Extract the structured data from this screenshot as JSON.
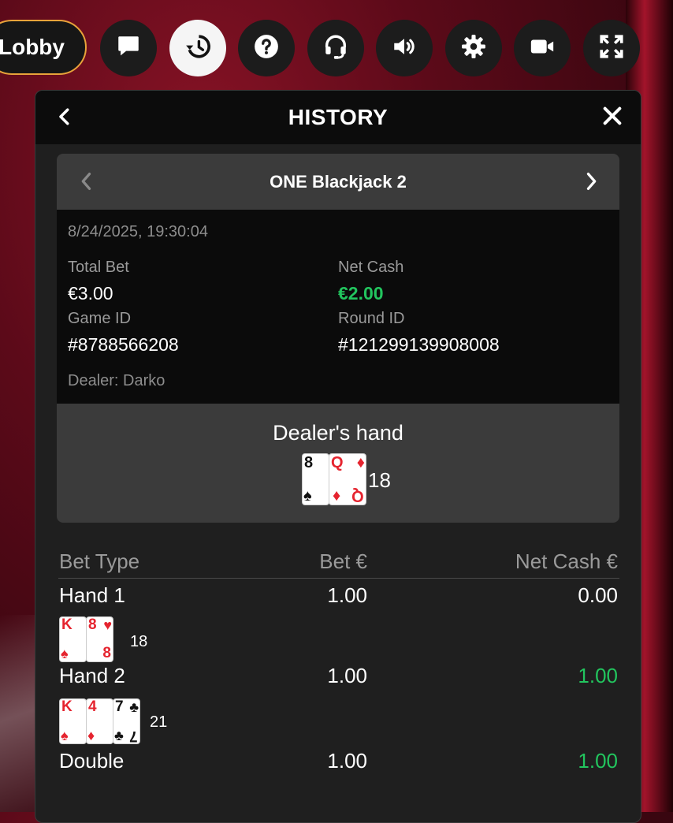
{
  "topbar": {
    "lobby_label": "Lobby",
    "icons": [
      "chat-icon",
      "history-icon",
      "help-icon",
      "support-icon",
      "sound-icon",
      "settings-icon",
      "video-icon",
      "fullscreen-icon"
    ],
    "active_icon": "history-icon",
    "accent": "#e8a33a"
  },
  "panel": {
    "title": "HISTORY"
  },
  "round": {
    "game_name": "ONE Blackjack 2",
    "timestamp": "8/24/2025, 19:30:04",
    "total_bet_label": "Total Bet",
    "total_bet": "€3.00",
    "net_cash_label": "Net Cash",
    "net_cash": "€2.00",
    "game_id_label": "Game ID",
    "game_id": "#8788566208",
    "round_id_label": "Round ID",
    "round_id": "#121299139908008",
    "dealer": "Dealer: Darko",
    "win_color": "#22c55e"
  },
  "dealer_hand": {
    "title": "Dealer's hand",
    "cards": [
      {
        "rank": "8",
        "suit": "♠",
        "color": "black"
      },
      {
        "rank": "Q",
        "suit": "♦",
        "color": "red"
      }
    ],
    "total": "18"
  },
  "table": {
    "headers": [
      "Bet Type",
      "Bet €",
      "Net Cash €"
    ],
    "rows": [
      {
        "type": "Hand 1",
        "bet": "1.00",
        "net": "0.00",
        "cards": [
          {
            "rank": "K",
            "suit": "♠",
            "color": "red"
          },
          {
            "rank": "8",
            "suit": "♥",
            "color": "red"
          }
        ],
        "total": "18"
      },
      {
        "type": "Hand 2",
        "bet": "1.00",
        "net": "1.00",
        "cards": [
          {
            "rank": "K",
            "suit": "♠",
            "color": "red"
          },
          {
            "rank": "4",
            "suit": "♦",
            "color": "red"
          },
          {
            "rank": "7",
            "suit": "♣",
            "color": "black"
          }
        ],
        "total": "21"
      },
      {
        "type": "Double",
        "bet": "1.00",
        "net": "1.00"
      }
    ]
  }
}
